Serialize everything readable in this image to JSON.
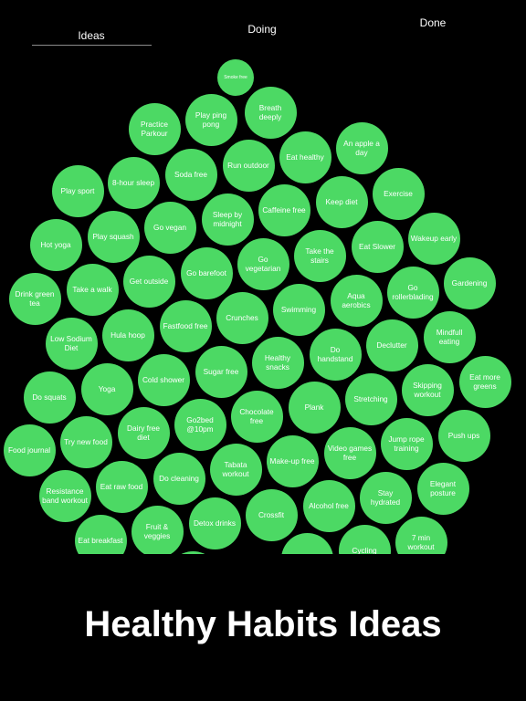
{
  "tabs": [
    {
      "label": "Ideas",
      "active": true
    },
    {
      "label": "Doing",
      "active": false
    },
    {
      "label": "Done",
      "active": false
    }
  ],
  "colors": {
    "bubble": "#4cd964",
    "background": "#000000",
    "text": "#ffffff"
  },
  "bubbles": [
    "Smoke free",
    "Practice Parkour",
    "Play ping pong",
    "Breath deeply",
    "Eat healthy",
    "An apple a day",
    "Run outdoor",
    "Soda free",
    "8-hour sleep",
    "Play sport",
    "Exercise",
    "Keep diet",
    "Caffeine free",
    "Sleep by midnight",
    "Go vegan",
    "Play squash",
    "Hot yoga",
    "Wakeup early",
    "Eat Slower",
    "Take the stairs",
    "Go vegetarian",
    "Go barefoot",
    "Get outside",
    "Take a walk",
    "Drink green tea",
    "Gardening",
    "Go rollerblading",
    "Aqua aerobics",
    "Swimming",
    "Crunches",
    "Fastfood free",
    "Hula hoop",
    "Low Sodium Diet",
    "Mindfull eating",
    "Declutter",
    "Do handstand",
    "Healthy snacks",
    "Sugar free",
    "Cold shower",
    "Yoga",
    "Do squats",
    "Eat more greens",
    "Skipping workout",
    "Stretching",
    "Plank",
    "Chocolate free",
    "Go2bed @10pm",
    "Dairy free diet",
    "Try new food",
    "Food journal",
    "Push ups",
    "Jump rope training",
    "Video games free",
    "Make-up free",
    "Tabata workout",
    "Do cleaning",
    "Eat raw food",
    "Resistance band workout",
    "Elegant posture",
    "Stay hydrated",
    "Alcohol free",
    "Crossfit",
    "Detox drinks",
    "Fruit & veggies",
    "Eat breakfast",
    "7 min workout",
    "Cycling",
    "",
    ""
  ],
  "footer": {
    "title": "Healthy Habits Ideas"
  }
}
